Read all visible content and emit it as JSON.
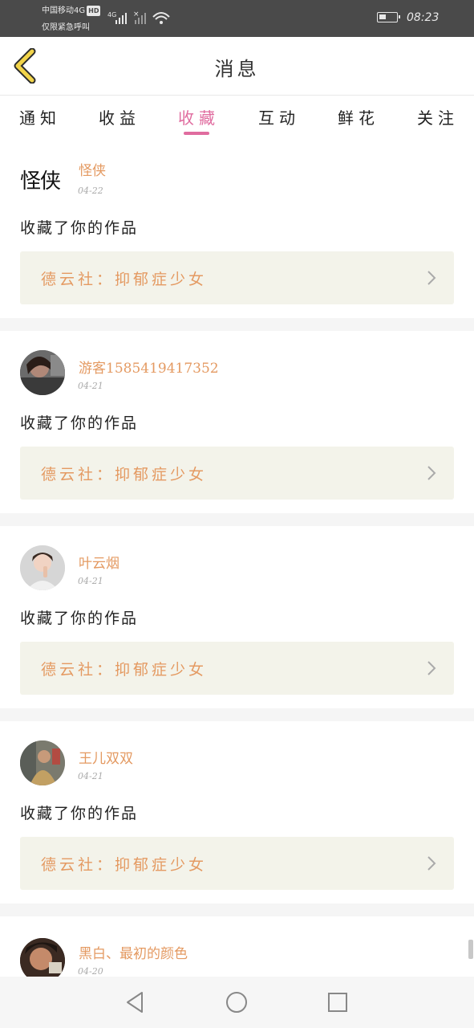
{
  "status_bar": {
    "carrier": "中国移动4G",
    "hd_badge": "HD",
    "emergency": "仅限紧急呼叫",
    "network": "4G",
    "time": "08:23"
  },
  "header": {
    "title": "消息",
    "back_icon": "back-chevron-icon"
  },
  "tabs": [
    {
      "label": "通知",
      "active": false
    },
    {
      "label": "收益",
      "active": false
    },
    {
      "label": "收藏",
      "active": true
    },
    {
      "label": "互动",
      "active": false
    },
    {
      "label": "鲜花",
      "active": false
    },
    {
      "label": "关注",
      "active": false
    }
  ],
  "colors": {
    "accent": "#e06c9f",
    "username": "#e49a62",
    "work_bg": "#f3f3ea",
    "statusbar": "#4a4a4a"
  },
  "feed": [
    {
      "username": "怪侠",
      "date": "04-22",
      "action": "收藏了你的作品",
      "work_title": "德云社：抑郁症少女",
      "avatar_text": "怪侠"
    },
    {
      "username": "游客1585419417352",
      "date": "04-21",
      "action": "收藏了你的作品",
      "work_title": "德云社：抑郁症少女"
    },
    {
      "username": "叶云烟",
      "date": "04-21",
      "action": "收藏了你的作品",
      "work_title": "德云社：抑郁症少女"
    },
    {
      "username": "王儿双双",
      "date": "04-21",
      "action": "收藏了你的作品",
      "work_title": "德云社：抑郁症少女"
    },
    {
      "username": "黑白、最初的颜色",
      "date": "04-20"
    }
  ],
  "nav_bar": {
    "back": "nav-back-icon",
    "home": "nav-home-icon",
    "recents": "nav-recents-icon"
  }
}
